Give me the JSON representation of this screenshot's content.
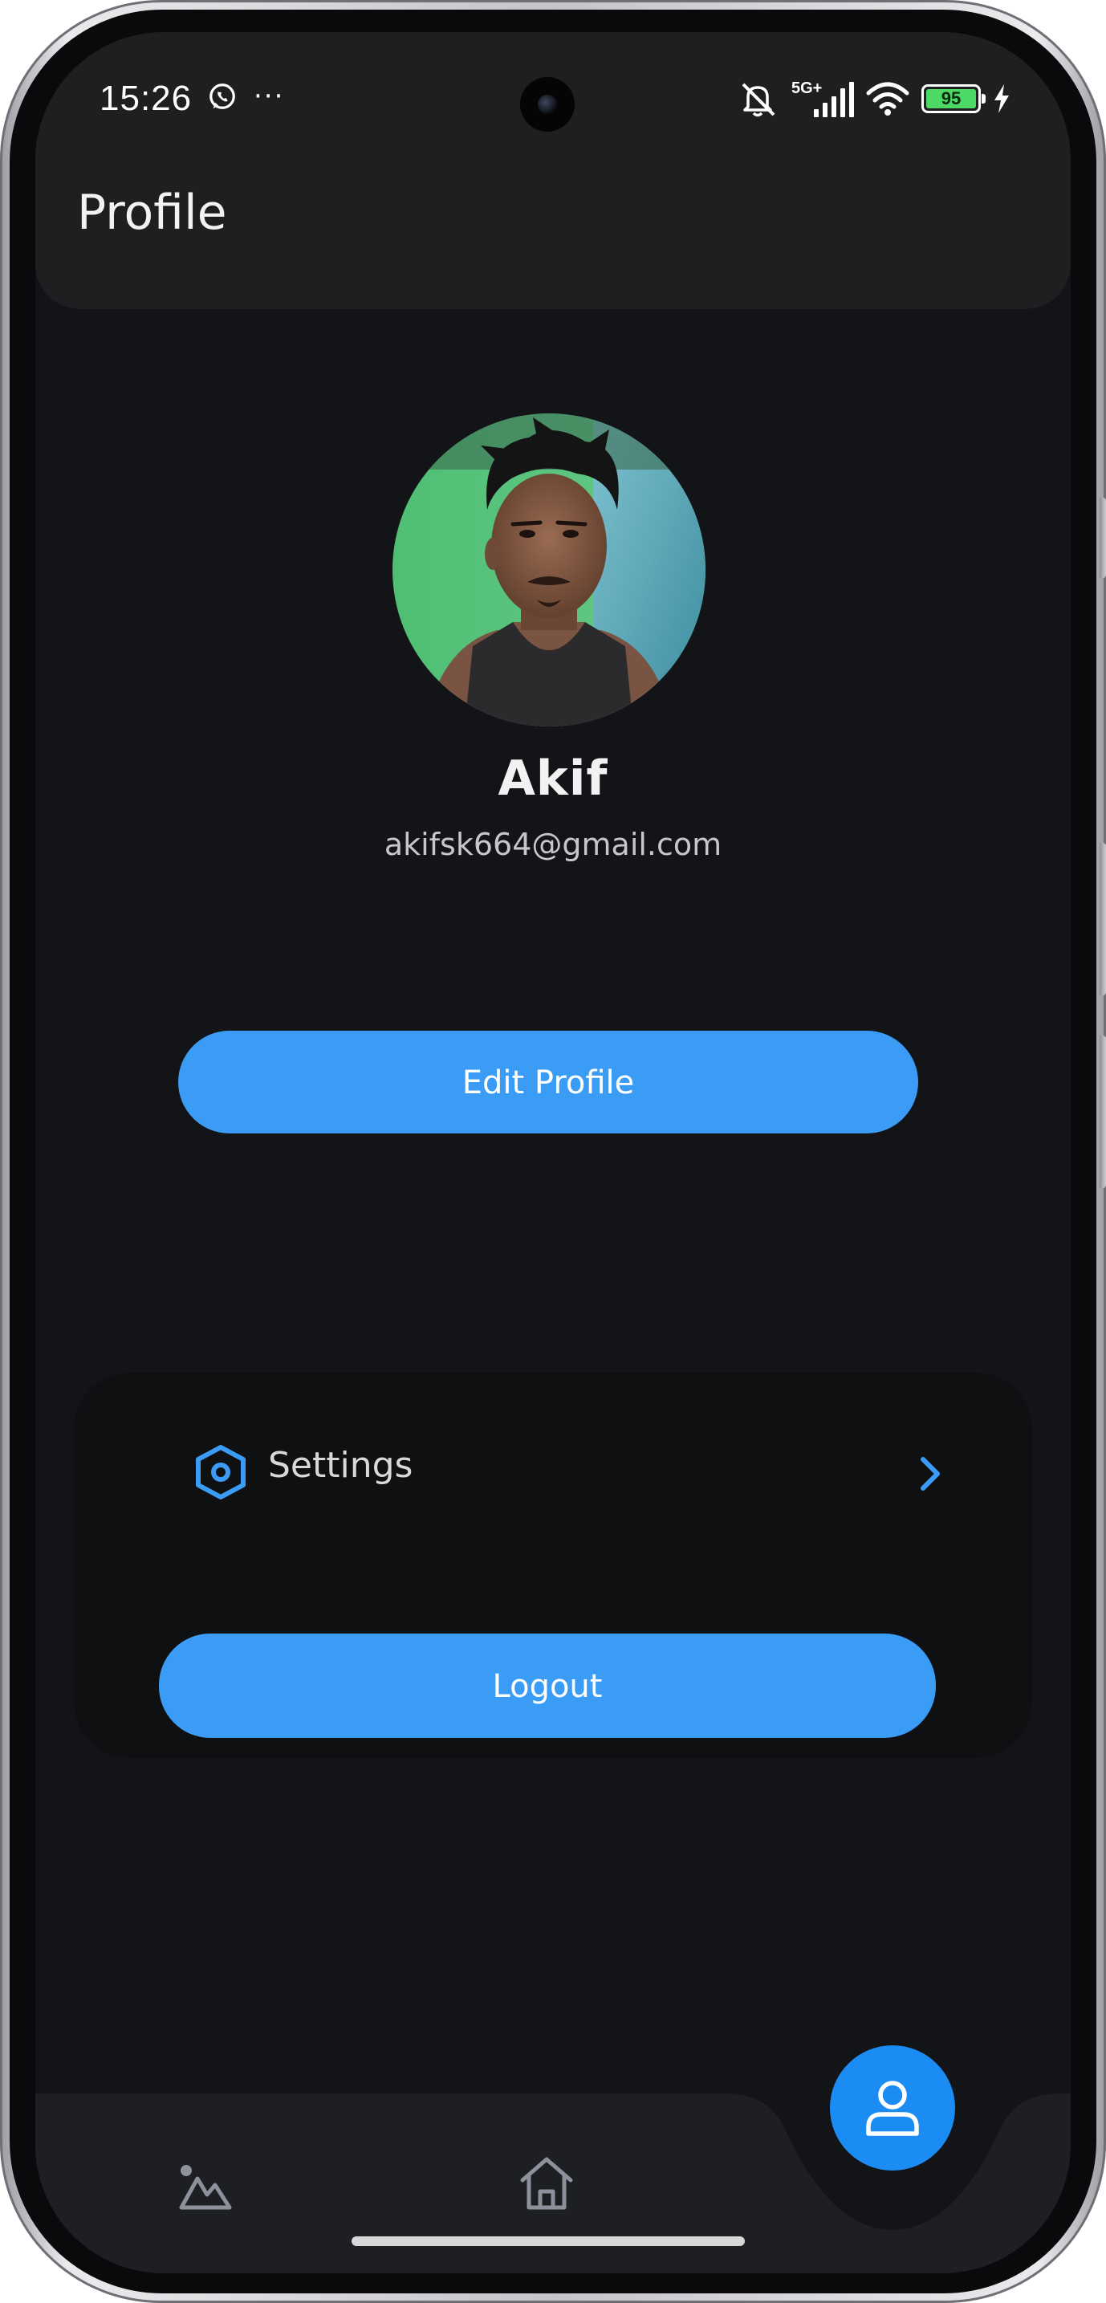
{
  "status_bar": {
    "time": "15:26",
    "more": "···",
    "network": "5G+",
    "battery_level": "95",
    "icons": [
      "whatsapp-icon",
      "more-dots-icon",
      "mute-icon",
      "signal-icon",
      "wifi-icon",
      "battery-icon",
      "charging-icon"
    ]
  },
  "header": {
    "title": "Profile"
  },
  "profile": {
    "name": "Akif",
    "email": "akifsk664@gmail.com",
    "edit_button": "Edit Profile"
  },
  "menu": {
    "settings_label": "Settings",
    "settings_icon": "settings-hex-icon",
    "logout_button": "Logout"
  },
  "bottom_nav": {
    "items": [
      "gallery-icon",
      "home-icon",
      "profile-icon"
    ],
    "active": "profile-icon"
  },
  "colors": {
    "accent": "#3a9cf5",
    "fab": "#1c8cf5",
    "background": "#131418",
    "app_bar": "#1f1f21",
    "card": "#0f1012"
  }
}
